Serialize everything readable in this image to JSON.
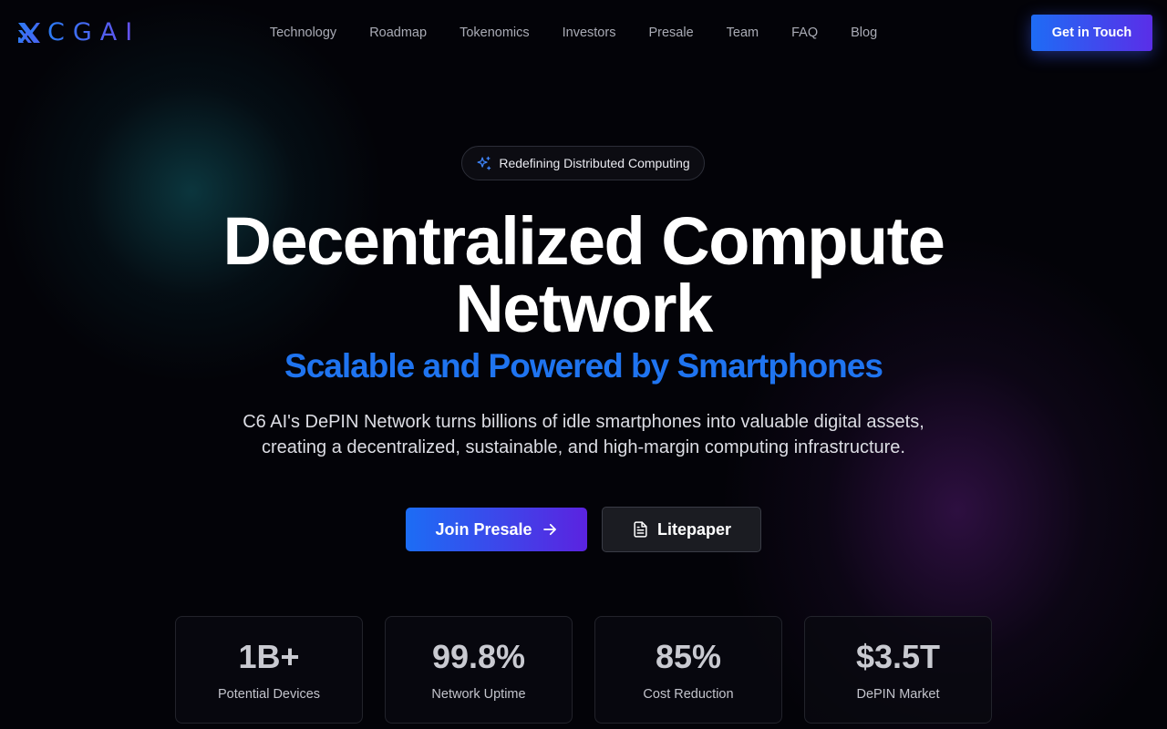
{
  "brand": {
    "logo_text": "CGAI"
  },
  "nav": {
    "links": [
      "Technology",
      "Roadmap",
      "Tokenomics",
      "Investors",
      "Presale",
      "Team",
      "FAQ",
      "Blog"
    ],
    "cta_label": "Get in Touch"
  },
  "hero": {
    "badge_text": "Redefining Distributed Computing",
    "title_line1": "Decentralized Compute",
    "title_line2": "Network",
    "subtitle": "Scalable and Powered by Smartphones",
    "description_line1": "C6 AI's DePIN Network turns billions of idle smartphones into valuable digital assets,",
    "description_line2": "creating a decentralized, sustainable, and high-margin computing infrastructure.",
    "primary_button": "Join Presale",
    "secondary_button": "Litepaper"
  },
  "stats": [
    {
      "value": "1B+",
      "label": "Potential Devices"
    },
    {
      "value": "99.8%",
      "label": "Network Uptime"
    },
    {
      "value": "85%",
      "label": "Cost Reduction"
    },
    {
      "value": "$3.5T",
      "label": "DePIN Market"
    }
  ],
  "colors": {
    "accent_blue": "#1f74f0",
    "accent_purple": "#5b23e0",
    "background": "#030308"
  },
  "icons": {
    "badge": "sparkle-icon",
    "primary_button": "arrow-right-icon",
    "secondary_button": "document-icon"
  }
}
